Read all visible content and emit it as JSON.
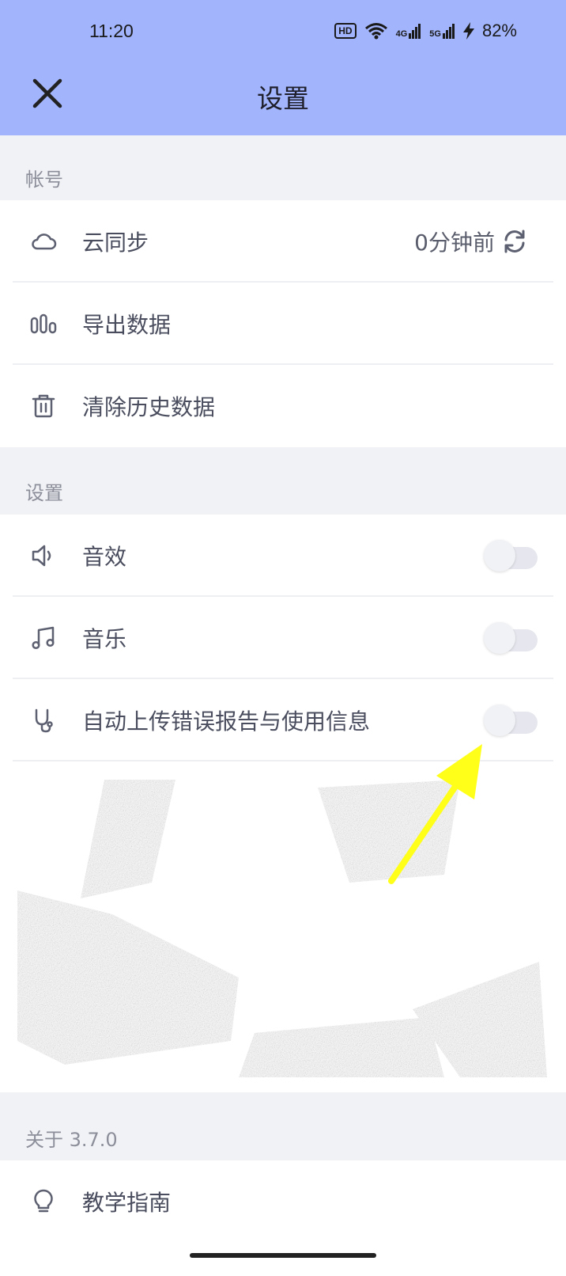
{
  "status_bar": {
    "time": "11:20",
    "hd": "HD",
    "net_4g": "4G",
    "net_5g": "5G",
    "battery": "82%"
  },
  "header": {
    "title": "设置"
  },
  "account_section": {
    "label": "帐号",
    "items": [
      {
        "label": "云同步",
        "value": "0分钟前",
        "icon": "cloud-icon"
      },
      {
        "label": "导出数据",
        "icon": "bar-chart-icon"
      },
      {
        "label": "清除历史数据",
        "icon": "trash-icon"
      }
    ]
  },
  "settings_section": {
    "label": "设置",
    "items": [
      {
        "label": "音效",
        "icon": "speaker-icon",
        "on": false
      },
      {
        "label": "音乐",
        "icon": "music-note-icon",
        "on": false
      },
      {
        "label": "自动上传错误报告与使用信息",
        "icon": "stethoscope-icon",
        "on": false
      }
    ]
  },
  "about_section": {
    "label": "关于 3.7.0",
    "items": [
      {
        "label": "教学指南",
        "icon": "lightbulb-icon"
      }
    ]
  },
  "annotation": {
    "color": "#ffff1a"
  },
  "colors": {
    "header_bg": "#a2b4fb",
    "page_bg": "#f1f2f6"
  }
}
